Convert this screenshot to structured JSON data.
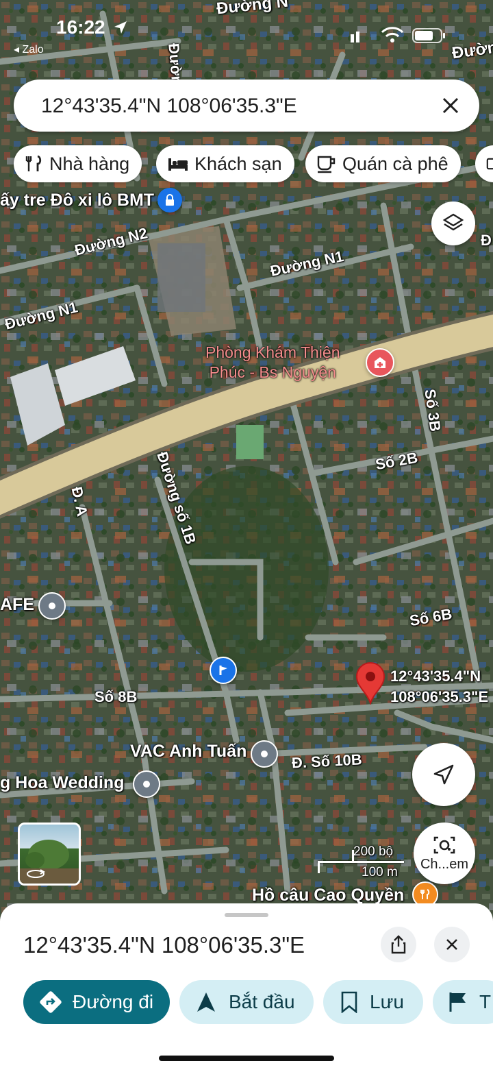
{
  "status_bar": {
    "time": "16:22",
    "back_app": "◂ Zalo"
  },
  "search": {
    "query": "12°43'35.4\"N 108°06'35.3\"E",
    "close_icon": "close-icon"
  },
  "categories": [
    {
      "label": "Nhà hàng",
      "icon": "restaurant-icon"
    },
    {
      "label": "Khách sạn",
      "icon": "hotel-icon"
    },
    {
      "label": "Quán cà phê",
      "icon": "coffee-icon"
    }
  ],
  "map": {
    "roads": {
      "top": "Đường N",
      "top_left": "Đường",
      "top_right": "Đườn",
      "n2": "Đường N2",
      "n1_right": "Đường N1",
      "n1_left": "Đường N1",
      "so3b": "Số 3B",
      "so2b": "Số 2B",
      "da": "Đ. A",
      "duong_so_1b": "Đường số 1B",
      "so6b": "Số 6B",
      "so8b": "Số 8B",
      "so10b": "Đ. Số 10B",
      "right_edge": "Đ"
    },
    "places": {
      "may_tre": "ấy tre Đô xi lô BMT",
      "clinic_line1": "Phòng Khám Thiện",
      "clinic_line2": "Phúc - Bs Nguyện",
      "cafe": "AFE",
      "vac": "VAC Anh Tuấn",
      "wedding": "g Hoa Wedding",
      "ho_cau": "Hồ câu Cao Quyền"
    },
    "pin": {
      "line1": "12°43'35.4\"N",
      "line2": "108°06'35.3\"E"
    },
    "scale": {
      "imperial": "200 bộ",
      "metric": "100 m"
    },
    "lens_label": "Ch...em",
    "colors": {
      "main_road": "#d8c99a",
      "road": "#8f9a92",
      "pin": "#e53935",
      "accent": "#0b7285"
    }
  },
  "sheet": {
    "title": "12°43'35.4\"N 108°06'35.3\"E",
    "actions": [
      {
        "label": "Đường đi",
        "icon": "directions-icon"
      },
      {
        "label": "Bắt đầu",
        "icon": "navigation-arrow-icon"
      },
      {
        "label": "Lưu",
        "icon": "bookmark-icon"
      },
      {
        "label": "T",
        "icon": "flag-icon"
      }
    ]
  }
}
